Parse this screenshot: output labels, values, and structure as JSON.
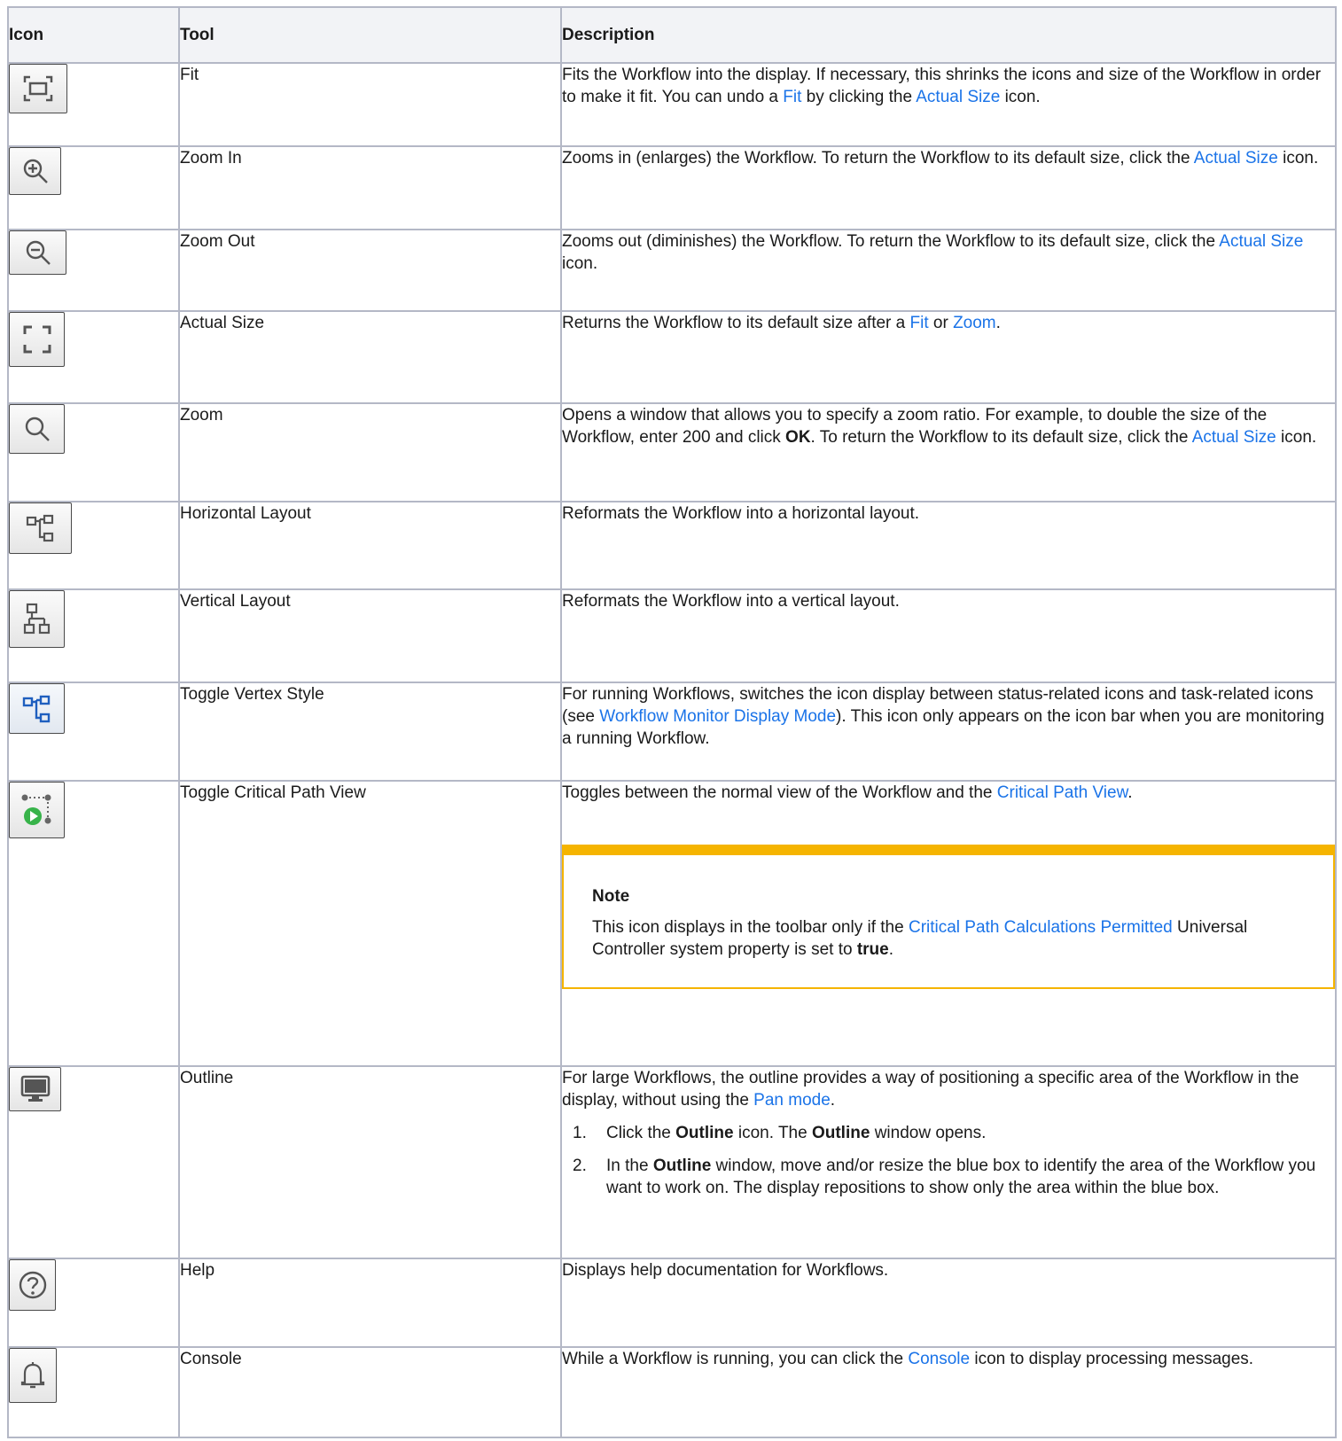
{
  "table": {
    "headers": {
      "icon": "Icon",
      "tool": "Tool",
      "description": "Description"
    },
    "rows": [
      {
        "icon": "fit-icon",
        "tool": "Fit",
        "desc": {
          "t1": "Fits the Workflow into the display. If necessary, this shrinks the icons and size of the Workflow in order to make it fit. You can undo a ",
          "l1": "Fit",
          "t2": " by clicking the ",
          "l2": "Actual Size",
          "t3": " icon."
        }
      },
      {
        "icon": "zoom-in-icon",
        "tool": "Zoom In",
        "desc": {
          "t1": "Zooms in (enlarges) the Workflow. To return the Workflow to its default size, click the ",
          "l1": "Actual Size",
          "t2": " icon."
        }
      },
      {
        "icon": "zoom-out-icon",
        "tool": "Zoom Out",
        "desc": {
          "t1": "Zooms out (diminishes) the Workflow. To return the Workflow to its default size, click the ",
          "l1": "Actual Size",
          "t2": " icon."
        }
      },
      {
        "icon": "actual-size-icon",
        "tool": "Actual Size",
        "desc": {
          "t1": "Returns the Workflow to its default size after a ",
          "l1": "Fit",
          "t2": " or ",
          "l2": "Zoom",
          "t3": "."
        }
      },
      {
        "icon": "zoom-icon",
        "tool": "Zoom",
        "desc": {
          "t1": "Opens a window that allows you to specify a zoom ratio. For example, to double the size of the Workflow, enter 200 and click ",
          "b1": "OK",
          "t2": ". To return the Workflow to its default size, click the ",
          "l1": "Actual Size",
          "t3": " icon."
        }
      },
      {
        "icon": "horizontal-layout-icon",
        "tool": "Horizontal Layout",
        "desc": {
          "t1": "Reformats the Workflow into a horizontal layout."
        }
      },
      {
        "icon": "vertical-layout-icon",
        "tool": "Vertical Layout",
        "desc": {
          "t1": "Reformats the Workflow into a vertical layout."
        }
      },
      {
        "icon": "toggle-vertex-style-icon",
        "tool": "Toggle Vertex Style",
        "desc": {
          "t1": "For running Workflows, switches the icon display between status-related icons and task-related icons (see ",
          "l1": "Workflow Monitor Display Mode",
          "t2": "). This icon only appears on the icon bar when you are monitoring a running Workflow."
        }
      },
      {
        "icon": "critical-path-icon",
        "tool": "Toggle Critical Path View",
        "desc": {
          "t1": "Toggles between the normal view of the Workflow and the ",
          "l1": "Critical Path View",
          "t2": "."
        },
        "note": {
          "title": "Note",
          "t1": "This icon displays in the toolbar only if the ",
          "l1": "Critical Path Calculations Permitted",
          "t2": " Universal Controller system property is set to ",
          "b1": "true",
          "t3": "."
        }
      },
      {
        "icon": "monitor-icon",
        "tool": "Outline",
        "desc": {
          "t1": "For large Workflows, the outline provides a way of positioning a specific area of the Workflow in the display, without using the ",
          "l1": "Pan mode",
          "t2": "."
        },
        "steps": [
          {
            "num": "1.",
            "t1": "Click the ",
            "b1": "Outline",
            "t2": " icon. The ",
            "b2": "Outline",
            "t3": " window opens."
          },
          {
            "num": "2.",
            "t1": "In the ",
            "b1": "Outline",
            "t2": " window, move and/or resize the blue box to identify the area of the Workflow you want to work on. The display repositions to show only the area within the blue box."
          }
        ]
      },
      {
        "icon": "help-icon",
        "tool": "Help",
        "desc": {
          "t1": "Displays help documentation for Workflows."
        }
      },
      {
        "icon": "bell-icon",
        "tool": "Console",
        "desc": {
          "t1": "While a Workflow is running, you can click the ",
          "l1": "Console",
          "t2": " icon to display processing messages."
        }
      }
    ]
  },
  "colors": {
    "link": "#1a73e8",
    "note_accent": "#f5b400",
    "border": "#b4b8c6",
    "header_bg": "#f2f3f6"
  }
}
